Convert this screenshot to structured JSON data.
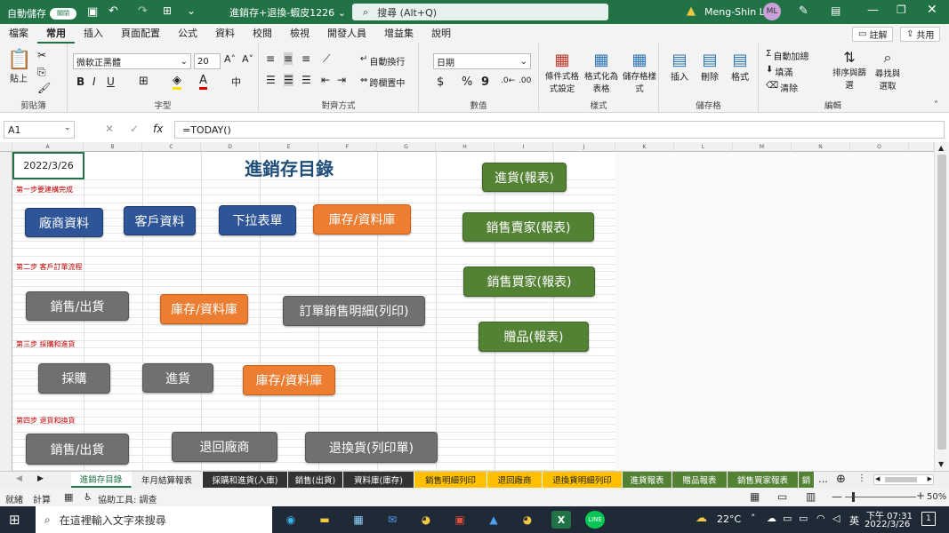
{
  "titlebar": {
    "autosave": "自動儲存",
    "toggle": "關閉",
    "filename": "進銷存+退換-蝦皮1226",
    "filename_caret": "⌄",
    "search": "搜尋 (Alt+Q)",
    "user": "Meng-Shin Li",
    "initials": "ML"
  },
  "menu": [
    "檔案",
    "常用",
    "插入",
    "頁面配置",
    "公式",
    "資料",
    "校閱",
    "檢視",
    "開發人員",
    "增益集",
    "說明"
  ],
  "topbuttons": {
    "comment": "註解",
    "share": "共用"
  },
  "ribbon": {
    "clipboard": {
      "paste": "貼上",
      "label": "剪貼簿"
    },
    "font": {
      "name": "微軟正黑體",
      "size": "20",
      "bold": "B",
      "italic": "I",
      "underline": "U",
      "label": "字型"
    },
    "align": {
      "wrap": "自動換行",
      "merge": "跨欄置中",
      "label": "對齊方式"
    },
    "number": {
      "format": "日期",
      "currency": "$",
      "percent": "%",
      "comma": "9",
      "label": "數值"
    },
    "styles": {
      "cond": "條件式格式設定",
      "table": "格式化為表格",
      "cell": "儲存格樣式",
      "label": "樣式"
    },
    "cells": {
      "insert": "插入",
      "delete": "刪除",
      "format": "格式",
      "label": "儲存格"
    },
    "edit": {
      "autosum": "自動加總",
      "fill": "填滿",
      "clear": "清除",
      "sort": "排序與篩選",
      "find": "尋找與選取",
      "label": "編輯"
    }
  },
  "formulabar": {
    "namebox": "A1",
    "formula": "=TODAY()"
  },
  "columns": [
    "A",
    "B",
    "C",
    "D",
    "E",
    "F",
    "G",
    "H",
    "I",
    "J",
    "K",
    "L",
    "M",
    "N",
    "O"
  ],
  "sheet": {
    "date": "2022/3/26",
    "title": "進銷存目錄",
    "steps": [
      "第一步要建構完成",
      "第二步 客戶訂單流程",
      "第三步 採購和進貨",
      "第四步 退貨和換貨"
    ],
    "buttons": [
      "廠商資料",
      "客戶資料",
      "下拉表單",
      "庫存/資料庫",
      "銷售/出貨",
      "庫存/資料庫",
      "訂單銷售明細(列印)",
      "採購",
      "進貨",
      "庫存/資料庫",
      "銷售/出貨",
      "退回廠商",
      "退換貨(列印單)"
    ],
    "reports": [
      "進貨(報表)",
      "銷售賣家(報表)",
      "銷售買家(報表)",
      "贈品(報表)"
    ]
  },
  "tabs": [
    "進銷存目錄",
    "年月結算報表",
    "採購和進貨(入庫)",
    "銷售(出貨)",
    "資料庫(庫存)",
    "銷售明細列印",
    "退回廠商",
    "退換貨明細列印",
    "進貨報表",
    "贈品報表",
    "銷售買家報表",
    "銷"
  ],
  "status": {
    "ready": "就緒",
    "calc": "計算",
    "access": "協助工具: 調查",
    "zoom": "50%"
  },
  "taskbar": {
    "search": "在這裡輸入文字來搜尋",
    "temp": "22°C",
    "lang": "英",
    "time": "下午 07:31",
    "date": "2022/3/26",
    "badge": "1"
  }
}
